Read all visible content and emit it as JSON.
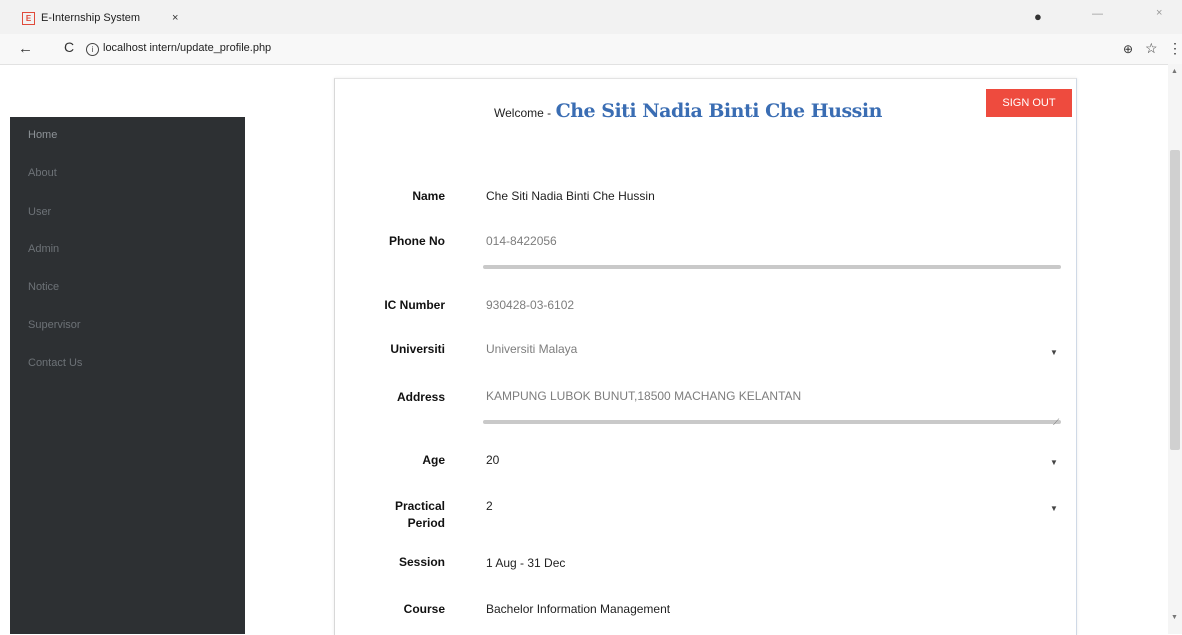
{
  "browser": {
    "tab_title": "E-Internship System",
    "tab_close": "×",
    "url": "localhost intern/update_profile.php",
    "icons": {
      "back": "←",
      "reload": "C",
      "info": "i",
      "profile": "●",
      "zoom": "⊕",
      "star": "☆",
      "menu": "⋮",
      "minimize": "—",
      "close": "×"
    }
  },
  "sidebar": {
    "items": [
      {
        "label": "Home"
      },
      {
        "label": "About"
      },
      {
        "label": "User"
      },
      {
        "label": "Admin"
      },
      {
        "label": "Notice"
      },
      {
        "label": "Supervisor"
      },
      {
        "label": "Contact Us"
      }
    ]
  },
  "header": {
    "welcome_prefix": "Welcome -",
    "user_name": "Che Siti Nadia Binti Che Hussin",
    "signout_label": "SIGN OUT"
  },
  "profile": {
    "name_label": "Name",
    "name_value": "Che Siti Nadia Binti Che Hussin",
    "phone_label": "Phone No",
    "phone_value": "014-8422056",
    "ic_label": "IC Number",
    "ic_value": "930428-03-6102",
    "university_label": "Universiti",
    "university_value": "Universiti Malaya",
    "address_label": "Address",
    "address_value": "KAMPUNG LUBOK BUNUT,18500 MACHANG KELANTAN",
    "age_label": "Age",
    "age_value": "20",
    "practical_label_1": "Practical",
    "practical_label_2": "Period",
    "practical_value": "2",
    "session_label": "Session",
    "session_value": "1 Aug - 31 Dec",
    "course_label": "Course",
    "course_value": "Bachelor Information Management"
  },
  "colors": {
    "sidebar_bg": "#2d3033",
    "signout_bg": "#ee4b3e",
    "welcome_name": "#3a6db3"
  }
}
